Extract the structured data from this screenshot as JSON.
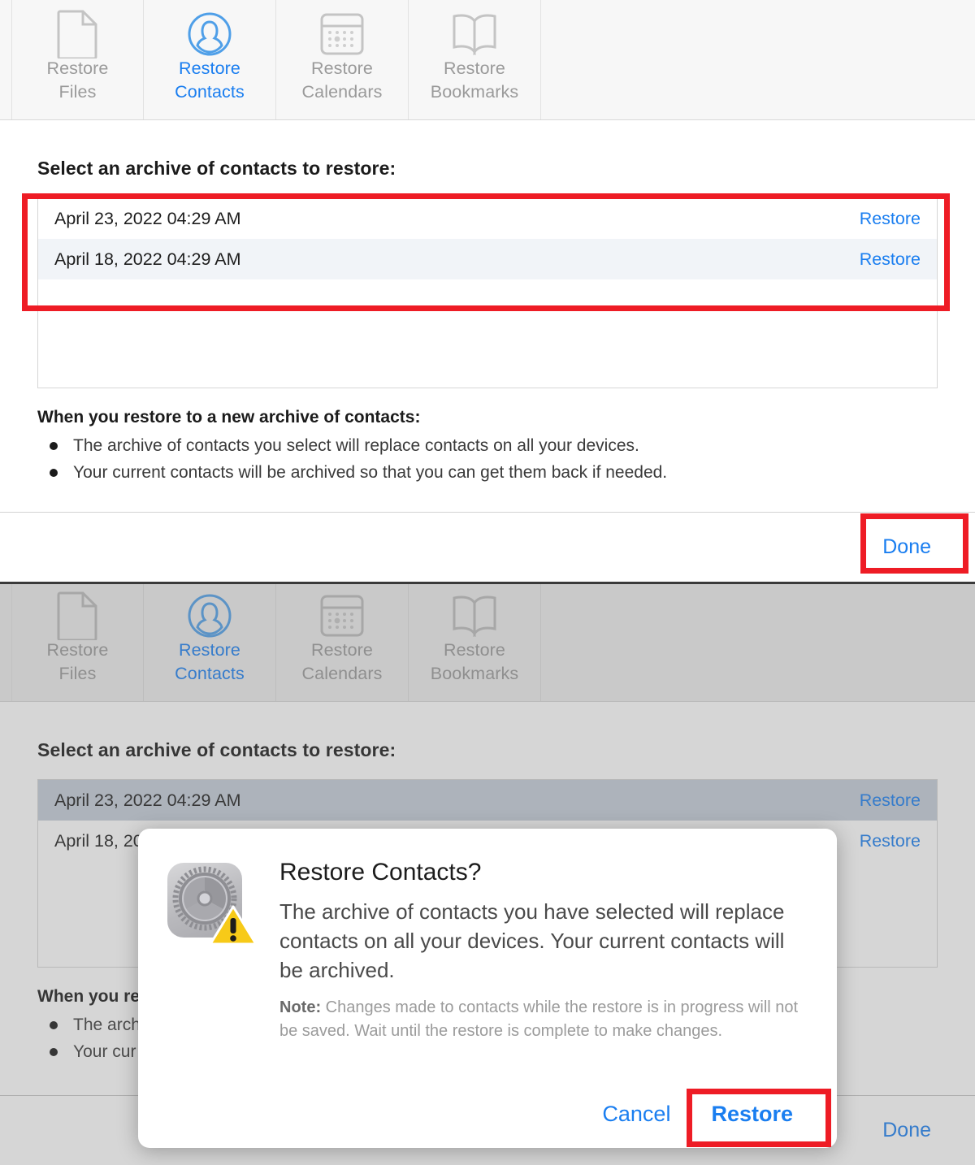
{
  "tabs": [
    {
      "id": "restore-files",
      "line1": "Restore",
      "line2": "Files",
      "icon": "document-icon",
      "active": false
    },
    {
      "id": "restore-contacts",
      "line1": "Restore",
      "line2": "Contacts",
      "icon": "contact-person-icon",
      "active": true
    },
    {
      "id": "restore-calendars",
      "line1": "Restore",
      "line2": "Calendars",
      "icon": "calendar-icon",
      "active": false
    },
    {
      "id": "restore-bookmarks",
      "line1": "Restore",
      "line2": "Bookmarks",
      "icon": "bookmark-book-icon",
      "active": false
    }
  ],
  "section": {
    "title": "Select an archive of contacts to restore:",
    "archives": [
      {
        "date": "April 23, 2022 04:29 AM",
        "action": "Restore"
      },
      {
        "date": "April 18, 2022 04:29 AM",
        "action": "Restore"
      }
    ],
    "archives_truncated": [
      {
        "date": "April 23, 2022 04:29 AM",
        "action": "Restore"
      },
      {
        "date": "April 18, 20",
        "action": "Restore"
      }
    ],
    "notes_heading": "When you restore to a new archive of contacts:",
    "notes": [
      "The archive of contacts you select will replace contacts on all your devices.",
      "Your current contacts will be archived so that you can get them back if needed."
    ],
    "notes_heading_truncated": "When you re",
    "notes_truncated": [
      "The arch",
      "Your cur"
    ]
  },
  "footer": {
    "done_label": "Done"
  },
  "dialog": {
    "icon": "settings-gear-warning-icon",
    "title": "Restore Contacts?",
    "message": "The archive of contacts you have selected will replace contacts on all your devices. Your current contacts will be archived.",
    "note_label": "Note:",
    "note_body": " Changes made to contacts while the restore is in progress will not be saved. Wait until the restore is complete to make changes.",
    "cancel_label": "Cancel",
    "restore_label": "Restore"
  },
  "colors": {
    "accent_blue": "#1a7ef0",
    "annotation_red": "#ee1c25",
    "tabbar_bg": "#f7f7f7",
    "row_alt_bg": "#f1f4f8",
    "row_selected_bg": "#c4cdd8",
    "warning_yellow": "#f5c518"
  }
}
